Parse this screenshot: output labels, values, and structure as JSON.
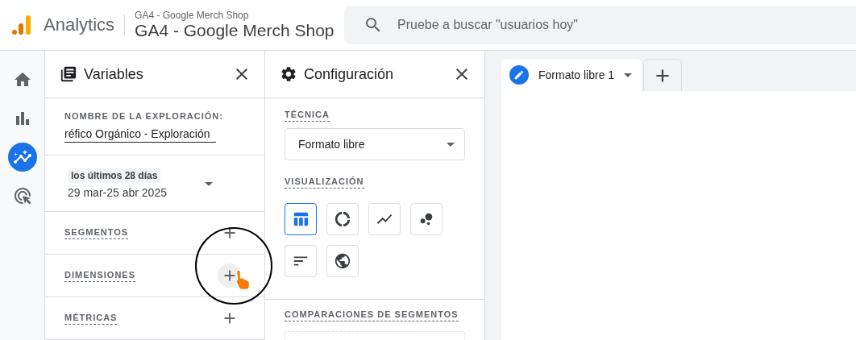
{
  "header": {
    "product": "Analytics",
    "account": "GA4 - Google Merch Shop",
    "property": "GA4 - Google Merch Shop",
    "search": {
      "placeholder": "Pruebe a buscar \"usuarios hoy\""
    }
  },
  "nav": [
    {
      "kind": "home",
      "selected": false
    },
    {
      "kind": "reports",
      "selected": false
    },
    {
      "kind": "explore",
      "selected": true
    },
    {
      "kind": "advertising",
      "selected": false
    }
  ],
  "variables": {
    "title": "Variables",
    "name_label": "NOMBRE DE LA EXPLORACIÓN:",
    "name_value": "réfico Orgánico - Exploración",
    "date_chip": "los últimos 28 días",
    "date_range": "29 mar-25 abr 2025",
    "sections": [
      {
        "label": "SEGMENTOS",
        "hovered": false
      },
      {
        "label": "DIMENSIONES",
        "hovered": true
      },
      {
        "label": "MÉTRICAS",
        "hovered": false
      }
    ]
  },
  "settings": {
    "title": "Configuración",
    "technique_label": "TÉCNICA",
    "technique_value": "Formato libre",
    "visualization_label": "VISUALIZACIÓN",
    "visualizations": [
      {
        "kind": "table",
        "selected": true
      },
      {
        "kind": "donut",
        "selected": false
      },
      {
        "kind": "line",
        "selected": false
      },
      {
        "kind": "scatter",
        "selected": false
      },
      {
        "kind": "bar",
        "selected": false
      },
      {
        "kind": "geo",
        "selected": false
      }
    ],
    "comparisons_label": "COMPARACIONES DE SEGMENTOS"
  },
  "tabs": [
    {
      "label": "Formato libre 1",
      "selected": true
    }
  ]
}
